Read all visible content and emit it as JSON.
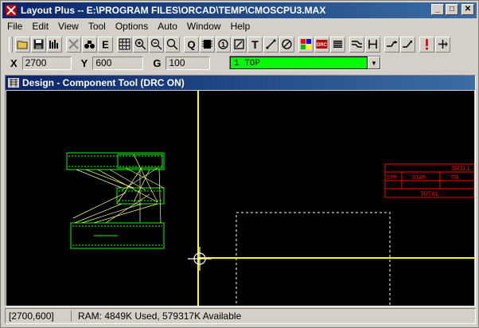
{
  "window": {
    "title": "Layout Plus -- E:\\PROGRAM FILES\\ORCAD\\TEMP\\CMOSCPU3.MAX",
    "minimize_label": "_",
    "maximize_label": "□",
    "close_label": "✕"
  },
  "menu": {
    "items": [
      {
        "label": "File"
      },
      {
        "label": "Edit"
      },
      {
        "label": "View"
      },
      {
        "label": "Tool"
      },
      {
        "label": "Options"
      },
      {
        "label": "Auto"
      },
      {
        "label": "Window"
      },
      {
        "label": "Help"
      }
    ]
  },
  "toolbar": {
    "icons": [
      "open-icon",
      "save-icon",
      "print-icon",
      "delete-icon",
      "spy-icon",
      "edit-icon",
      "grid-icon",
      "zoom-in-icon",
      "zoom-out-icon",
      "zoom-all-icon",
      "query-icon",
      "component-icon",
      "pad-icon",
      "obstacle-icon",
      "text-icon",
      "connection-icon",
      "error-icon",
      "color-icon",
      "drc-icon",
      "reconnect-icon",
      "route-icon",
      "refresh-icon",
      "sweep-icon",
      "shove-icon",
      "split-icon",
      "alert-icon"
    ],
    "text_icons": {
      "query": "Q",
      "text": "T",
      "drc": "DRC",
      "edit": "E"
    }
  },
  "coords": {
    "x_label": "X",
    "x_value": "2700",
    "y_label": "Y",
    "y_value": "600",
    "g_label": "G",
    "g_value": "100",
    "layer_value": "1 TOP"
  },
  "design_window": {
    "title": "Design - Component Tool (DRC ON)"
  },
  "drill_chart": {
    "title": "DRILL C",
    "col_sym": "SYM",
    "col_diam": "DIAM",
    "col_tol": "TOL",
    "total_label": "TOTAL"
  },
  "colors": {
    "layer_green": "#00ff00",
    "board_outline": "#ffff00",
    "component": "#00ff00",
    "drill_chart": "#ff0000",
    "title_dark": "#0a246a",
    "title_light": "#3a6ea5"
  },
  "status": {
    "coord": "[2700,600]",
    "memory": "RAM: 4849K Used, 579317K Available"
  }
}
